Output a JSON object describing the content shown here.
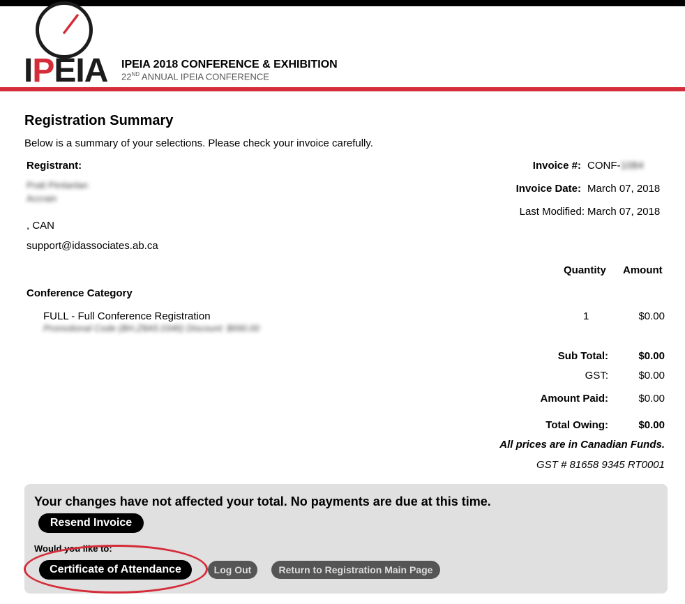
{
  "header": {
    "logo_text_first": "I",
    "logo_text_red": "P",
    "logo_text_rest": "EIA",
    "title": "IPEIA 2018 CONFERENCE & EXHIBITION",
    "subtitle_num": "22",
    "subtitle_sup": "ND",
    "subtitle_rest": " ANNUAL IPEIA CONFERENCE"
  },
  "summary": {
    "heading": "Registration Summary",
    "intro": "Below is a summary of your selections. Please check your invoice carefully."
  },
  "registrant": {
    "label": "Registrant:",
    "name": "Pratt Pimlanlan",
    "company": "Accrain",
    "location": ", CAN",
    "email": "support@idassociates.ab.ca"
  },
  "invoice": {
    "number_label": "Invoice #:",
    "number_value": "CONF-1084",
    "date_label": "Invoice Date:",
    "date_value": "March 07, 2018",
    "modified_label": "Last Modified:",
    "modified_value": "March 07, 2018"
  },
  "table": {
    "col_quantity": "Quantity",
    "col_amount": "Amount",
    "category": "Conference Category",
    "item_name": "FULL - Full Conference Registration",
    "item_promo": "Promotional Code (BH.Z8A5.0346) Discount: $690.00",
    "item_qty": "1",
    "item_amount": "$0.00"
  },
  "totals": {
    "subtotal_label": "Sub Total:",
    "subtotal_value": "$0.00",
    "gst_label": "GST:",
    "gst_value": "$0.00",
    "paid_label": "Amount Paid:",
    "paid_value": "$0.00",
    "owing_label": "Total Owing:",
    "owing_value": "$0.00",
    "funds_note": "All prices are in Canadian Funds.",
    "gst_number": "GST # 81658 9345 RT0001"
  },
  "panel": {
    "message": "Your changes have not affected your total. No payments are due at this time.",
    "resend_label": "Resend Invoice",
    "would_like": "Would you like to:",
    "certificate_label": "Certificate of Attendance",
    "logout_label": "Log Out",
    "return_label": "Return to Registration Main Page"
  },
  "colors": {
    "brand_red": "#d42c38",
    "dark": "#1c1c1c",
    "panel_bg": "#e0e0e0"
  }
}
